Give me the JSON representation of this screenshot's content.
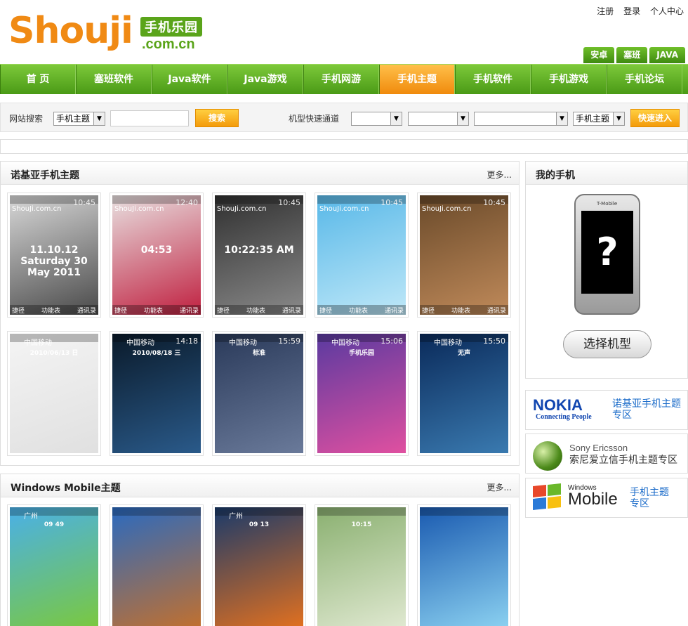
{
  "header": {
    "logo_text": "Shouji",
    "logo_tag": "手机乐园",
    "logo_domain": ".com.cn",
    "top_links": [
      "注册",
      "登录",
      "个人中心"
    ],
    "mini_tabs": [
      "安卓",
      "塞班",
      "JAVA"
    ]
  },
  "nav": {
    "items": [
      "首 页",
      "塞班软件",
      "Java软件",
      "Java游戏",
      "手机网游",
      "手机主题",
      "手机软件",
      "手机游戏",
      "手机论坛"
    ],
    "active_index": 5
  },
  "search": {
    "label": "网站搜索",
    "category_select": "手机主题",
    "query": "",
    "search_button": "搜索",
    "quick_label": "机型快速通道",
    "quick_select_1": "",
    "quick_select_2": "",
    "quick_select_3": "",
    "quick_category": "手机主题",
    "go_button": "快速进入"
  },
  "nokia_section": {
    "title": "诺基亚手机主题",
    "more": "更多...",
    "themes": [
      {
        "site": "ShouJi.com.cn",
        "time": "10:45",
        "big": "11.10.12 Saturday 30 May 2011",
        "left": "捷径",
        "mid": "功能表",
        "right": "通讯录",
        "colors": [
          "#d8d8d8",
          "#4a4a4a"
        ]
      },
      {
        "site": "ShouJi.com.cn",
        "time": "12:40",
        "big": "04:53",
        "left": "捷径",
        "mid": "功能表",
        "right": "通讯录",
        "colors": [
          "#e8e0e0",
          "#c02040"
        ]
      },
      {
        "site": "ShouJi.com.cn",
        "time": "10:45",
        "big": "10:22:35 AM",
        "left": "捷径",
        "mid": "功能表",
        "right": "通讯录",
        "colors": [
          "#303030",
          "#8a8a8a"
        ]
      },
      {
        "site": "ShouJi.com.cn",
        "time": "10:45",
        "big": "",
        "left": "捷径",
        "mid": "功能表",
        "right": "通讯录",
        "colors": [
          "#58b8e8",
          "#bfe8f8"
        ]
      },
      {
        "site": "ShouJi.com.cn",
        "time": "10:45",
        "big": "",
        "left": "捷径",
        "mid": "功能表",
        "right": "通讯录",
        "colors": [
          "#6a4a2a",
          "#c08a5a"
        ]
      },
      {
        "op": "中国移动",
        "time": "",
        "big": "2010/06/13 日",
        "colors": [
          "#f4f4f4",
          "#e0e0e0"
        ]
      },
      {
        "op": "中国移动",
        "time": "14:18",
        "big": "2010/08/18 三",
        "colors": [
          "#0a1a2a",
          "#2a5a8a"
        ]
      },
      {
        "op": "中国移动",
        "time": "15:59",
        "big": "标准",
        "colors": [
          "#2a3a5a",
          "#6a7a9a"
        ]
      },
      {
        "op": "中国移动",
        "time": "15:06",
        "big": "手机乐园",
        "colors": [
          "#5a3aa0",
          "#e050a0"
        ]
      },
      {
        "op": "中国移动",
        "time": "15:50",
        "big": "无声",
        "colors": [
          "#0a2a5a",
          "#3a7ab0"
        ]
      }
    ]
  },
  "wm_section": {
    "title": "Windows Mobile主题",
    "more": "更多...",
    "themes": [
      {
        "op": "广州",
        "big": "09 49",
        "colors": [
          "#4ab0e8",
          "#7ac840"
        ]
      },
      {
        "op": "",
        "big": "",
        "colors": [
          "#2a6ac0",
          "#c07030"
        ]
      },
      {
        "op": "广州",
        "big": "09 13",
        "colors": [
          "#1a3a6a",
          "#e07020"
        ]
      },
      {
        "op": "",
        "big": "10:15",
        "colors": [
          "#8ab070",
          "#dfe8d0"
        ]
      },
      {
        "op": "",
        "big": "",
        "colors": [
          "#1a5ab0",
          "#8ad0f0"
        ]
      }
    ]
  },
  "side": {
    "title": "我的手机",
    "phone_brand": "T-Mobile",
    "phone_mark": "?",
    "choose_button": "选择机型",
    "nokia_logo": "NOKIA",
    "nokia_slogan": "Connecting People",
    "nokia_link_1": "诺基亚手机主题",
    "nokia_link_2": "专区",
    "se_name": "Sony Ericsson",
    "se_link": "索尼爱立信手机主题专区",
    "wm_small": "Windows",
    "wm_big": "Mobile",
    "wm_link_1": "手机主题",
    "wm_link_2": "专区"
  }
}
